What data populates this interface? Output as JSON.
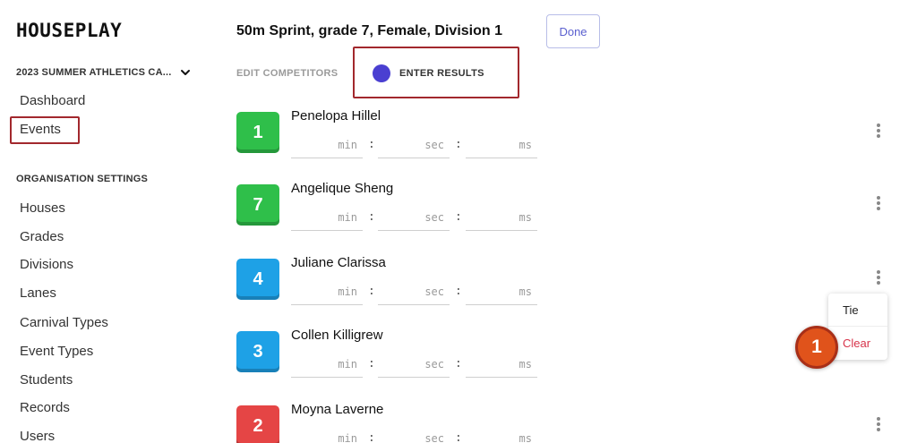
{
  "sidebar": {
    "brand": "HOUSEPLAY",
    "carnival": "2023 SUMMER ATHLETICS CA...",
    "nav_top": [
      {
        "label": "Dashboard"
      },
      {
        "label": "Events"
      }
    ],
    "section_label": "ORGANISATION SETTINGS",
    "nav_settings": [
      {
        "label": "Houses"
      },
      {
        "label": "Grades"
      },
      {
        "label": "Divisions"
      },
      {
        "label": "Lanes"
      },
      {
        "label": "Carnival Types"
      },
      {
        "label": "Event Types"
      },
      {
        "label": "Students"
      },
      {
        "label": "Records"
      },
      {
        "label": "Users"
      }
    ]
  },
  "header": {
    "title": "50m Sprint, grade 7, Female, Division 1",
    "done_label": "Done"
  },
  "tabs": {
    "edit": "EDIT COMPETITORS",
    "enter": "ENTER RESULTS"
  },
  "placeholders": {
    "min": "min",
    "sec": "sec",
    "ms": "ms",
    "separator": ":"
  },
  "competitors": [
    {
      "lane": "1",
      "name": "Penelopa Hillel",
      "color": "#2fbf4a"
    },
    {
      "lane": "7",
      "name": "Angelique Sheng",
      "color": "#2fbf4a"
    },
    {
      "lane": "4",
      "name": "Juliane Clarissa",
      "color": "#1ea1e6"
    },
    {
      "lane": "3",
      "name": "Collen Killigrew",
      "color": "#1ea1e6"
    },
    {
      "lane": "2",
      "name": "Moyna Laverne",
      "color": "#e54545"
    }
  ],
  "menu": {
    "tie": "Tie",
    "clear": "Clear"
  },
  "marker": "1",
  "colors": {
    "accent": "#4a3fd1",
    "highlight": "#a2282d",
    "marker": "#e0531b",
    "danger": "#d7334a"
  }
}
